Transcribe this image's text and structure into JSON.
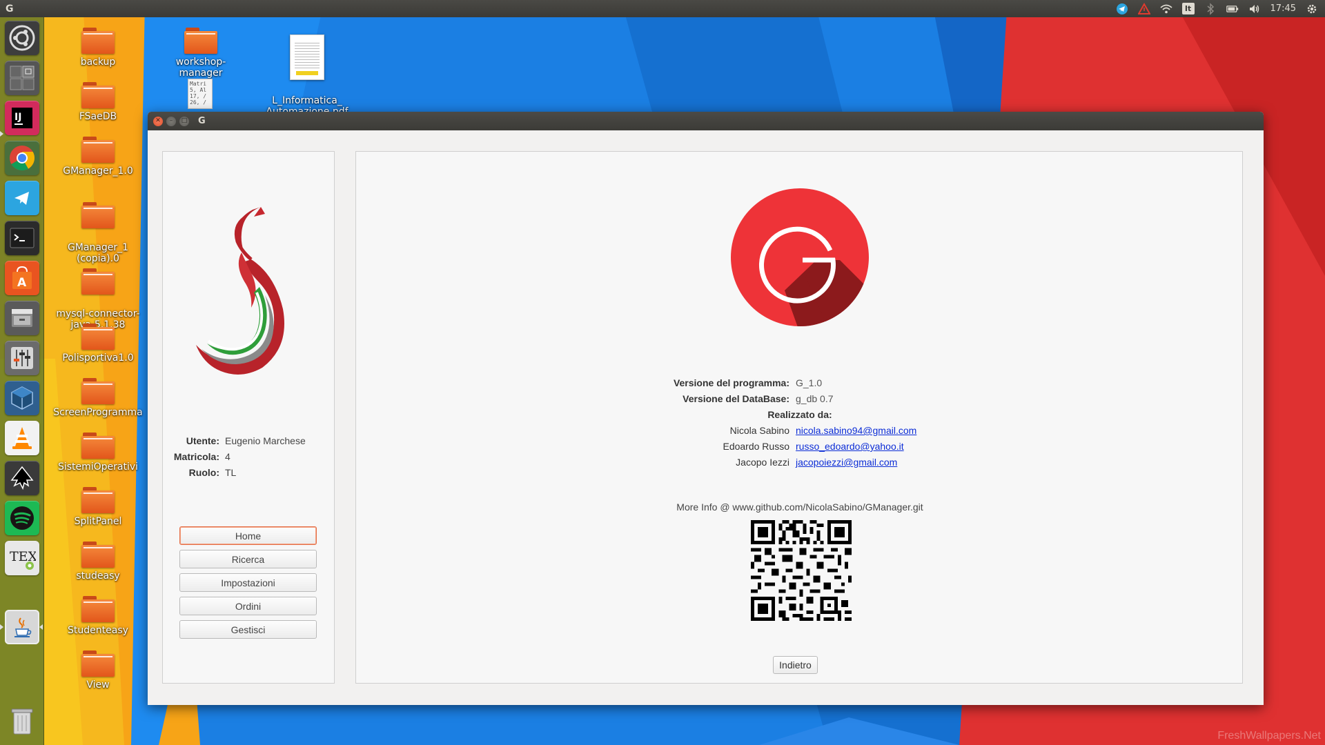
{
  "top_panel": {
    "app_name": "G",
    "keyboard_layout": "It",
    "clock": "17:45"
  },
  "launcher": {
    "items": [
      {
        "name": "ubuntu-dash"
      },
      {
        "name": "workspace-switcher"
      },
      {
        "name": "intellij-idea"
      },
      {
        "name": "chrome"
      },
      {
        "name": "telegram"
      },
      {
        "name": "terminal"
      },
      {
        "name": "software-center"
      },
      {
        "name": "files"
      },
      {
        "name": "system-settings"
      },
      {
        "name": "virtualbox"
      },
      {
        "name": "vlc"
      },
      {
        "name": "inkscape"
      },
      {
        "name": "spotify"
      },
      {
        "name": "texmaker"
      },
      {
        "name": "java"
      },
      {
        "name": "trash"
      }
    ],
    "texmaker_label": "TEX"
  },
  "desktop": {
    "icons": [
      {
        "label": "backup"
      },
      {
        "label": "FSaeDB"
      },
      {
        "label": "GManager_1.0"
      },
      {
        "label": "GManager_1\n(copia).0"
      },
      {
        "label": "mysql-connector-\njava-5.1.38"
      },
      {
        "label": "Polisportiva1.0"
      },
      {
        "label": "ScreenProgramma"
      },
      {
        "label": "SistemiOperativi"
      },
      {
        "label": "SplitPanel"
      },
      {
        "label": "studeasy"
      },
      {
        "label": "Studenteasy"
      },
      {
        "label": "View"
      },
      {
        "label": "workshop-manager"
      },
      {
        "label": "L_Informatica_\nAutomazione.pdf"
      }
    ],
    "txt_preview": "Matri\n5, Al\n17, /\n26, /"
  },
  "window": {
    "title": "G",
    "user": {
      "labels": {
        "user": "Utente:",
        "id": "Matricola:",
        "role": "Ruolo:"
      },
      "values": {
        "user": "Eugenio Marchese",
        "id": "4",
        "role": "TL"
      }
    },
    "nav": [
      "Home",
      "Ricerca",
      "Impostazioni",
      "Ordini",
      "Gestisci"
    ],
    "about": {
      "program_version_label": "Versione del programma:",
      "program_version": "G_1.0",
      "db_version_label": "Versione del DataBase:",
      "db_version": "g_db 0.7",
      "credits_label": "Realizzato da:",
      "authors": [
        {
          "name": "Nicola Sabino",
          "email": "nicola.sabino94@gmail.com"
        },
        {
          "name": "Edoardo Russo",
          "email": "russo_edoardo@yahoo.it"
        },
        {
          "name": "Jacopo Iezzi",
          "email": "jacopoiezzi@gmail.com"
        }
      ],
      "more_info": "More Info @ www.github.com/NicolaSabino/GManager.git",
      "back_button": "Indietro"
    }
  },
  "watermark": "FreshWallpapers.Net",
  "colors": {
    "accent_red": "#ee3338",
    "dark_red": "#8c1a1c",
    "link": "#0b2cd6"
  }
}
